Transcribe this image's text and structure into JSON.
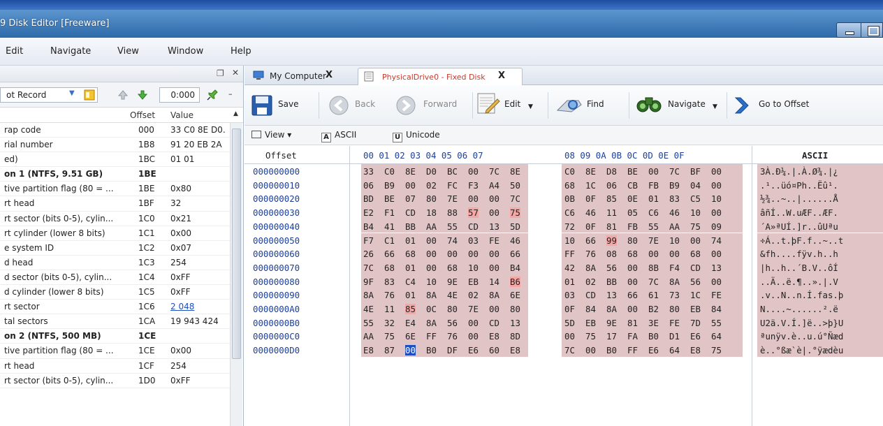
{
  "window": {
    "title": "9 Disk Editor [Freeware]"
  },
  "menu": [
    "Edit",
    "Navigate",
    "View",
    "Window",
    "Help"
  ],
  "left_panel": {
    "combo_value": "ot Record",
    "offset_value": "0:000",
    "columns": {
      "offset": "Offset",
      "value": "Value"
    },
    "rows": [
      {
        "name": "rap code",
        "offset": "000",
        "value": "33 C0 8E D0.",
        "bold": false
      },
      {
        "name": "rial number",
        "offset": "1B8",
        "value": "91 20 EB 2A",
        "bold": false
      },
      {
        "name": "ed)",
        "offset": "1BC",
        "value": "01 01",
        "bold": false
      },
      {
        "name": "on 1 (NTFS, 9.51 GB)",
        "offset": "1BE",
        "value": "",
        "bold": true
      },
      {
        "name": "tive partition flag (80 = ...",
        "offset": "1BE",
        "value": "0x80",
        "bold": false
      },
      {
        "name": "rt head",
        "offset": "1BF",
        "value": "32",
        "bold": false
      },
      {
        "name": "rt sector (bits 0-5), cylin...",
        "offset": "1C0",
        "value": "0x21",
        "bold": false
      },
      {
        "name": "rt cylinder (lower 8 bits)",
        "offset": "1C1",
        "value": "0x00",
        "bold": false
      },
      {
        "name": "e system ID",
        "offset": "1C2",
        "value": "0x07",
        "bold": false
      },
      {
        "name": "d head",
        "offset": "1C3",
        "value": "254",
        "bold": false
      },
      {
        "name": "d sector (bits 0-5), cylin...",
        "offset": "1C4",
        "value": "0xFF",
        "bold": false
      },
      {
        "name": "d cylinder (lower 8 bits)",
        "offset": "1C5",
        "value": "0xFF",
        "bold": false
      },
      {
        "name": "rt sector",
        "offset": "1C6",
        "value": "2 048",
        "bold": false,
        "link": true
      },
      {
        "name": "tal sectors",
        "offset": "1CA",
        "value": "19 943 424",
        "bold": false
      },
      {
        "name": "on 2 (NTFS, 500 MB)",
        "offset": "1CE",
        "value": "",
        "bold": true
      },
      {
        "name": "tive partition flag (80 = ...",
        "offset": "1CE",
        "value": "0x00",
        "bold": false
      },
      {
        "name": "rt head",
        "offset": "1CF",
        "value": "254",
        "bold": false
      },
      {
        "name": "rt sector (bits 0-5), cylin...",
        "offset": "1D0",
        "value": "0xFF",
        "bold": false
      }
    ]
  },
  "tabs": [
    {
      "label": "My Computer",
      "close": "X"
    },
    {
      "label": "PhysicalDrive0 - Fixed Disk",
      "close": "X"
    }
  ],
  "toolbar": {
    "save": "Save",
    "back": "Back",
    "forward": "Forward",
    "edit": "Edit",
    "find": "Find",
    "navigate": "Navigate",
    "goto": "Go to Offset"
  },
  "viewbar": {
    "view": "View",
    "ascii": "ASCII",
    "unicode": "Unicode"
  },
  "hex": {
    "offset_header": "Offset",
    "col_header_1": "00 01 02 03 04 05 06 07",
    "col_header_2": "08 09 0A 0B 0C 0D 0E 0F",
    "ascii_header": "ASCII",
    "rows": [
      {
        "offset": "000000000",
        "bytes": [
          "33",
          "C0",
          "8E",
          "D0",
          "BC",
          "00",
          "7C",
          "8E",
          "C0",
          "8E",
          "D8",
          "BE",
          "00",
          "7C",
          "BF",
          "00"
        ],
        "ascii": "3À.Ð¼.|.À.Ø¾.|¿"
      },
      {
        "offset": "000000010",
        "bytes": [
          "06",
          "B9",
          "00",
          "02",
          "FC",
          "F3",
          "A4",
          "50",
          "68",
          "1C",
          "06",
          "CB",
          "FB",
          "B9",
          "04",
          "00"
        ],
        "ascii": ".¹..üó¤Ph..Ëû¹."
      },
      {
        "offset": "000000020",
        "bytes": [
          "BD",
          "BE",
          "07",
          "80",
          "7E",
          "00",
          "00",
          "7C",
          "0B",
          "0F",
          "85",
          "0E",
          "01",
          "83",
          "C5",
          "10"
        ],
        "ascii": "½¾..~..|......Å"
      },
      {
        "offset": "000000030",
        "bytes": [
          "E2",
          "F1",
          "CD",
          "18",
          "88",
          "57",
          "00",
          "75",
          "C6",
          "46",
          "11",
          "05",
          "C6",
          "46",
          "10",
          "00"
        ],
        "ascii": "âñÍ..W.uÆF..ÆF."
      },
      {
        "offset": "000000040",
        "bytes": [
          "B4",
          "41",
          "BB",
          "AA",
          "55",
          "CD",
          "13",
          "5D",
          "72",
          "0F",
          "81",
          "FB",
          "55",
          "AA",
          "75",
          "09"
        ],
        "ascii": "´A»ªUÍ.]r..ûUªu"
      },
      {
        "offset": "000000050",
        "bytes": [
          "F7",
          "C1",
          "01",
          "00",
          "74",
          "03",
          "FE",
          "46",
          "10",
          "66",
          "99",
          "80",
          "7E",
          "10",
          "00",
          "74"
        ],
        "ascii": "÷Á..t.þF.f..~..t"
      },
      {
        "offset": "000000060",
        "bytes": [
          "26",
          "66",
          "68",
          "00",
          "00",
          "00",
          "00",
          "66",
          "FF",
          "76",
          "08",
          "68",
          "00",
          "00",
          "68",
          "00"
        ],
        "ascii": "&fh....fÿv.h..h"
      },
      {
        "offset": "000000070",
        "bytes": [
          "7C",
          "68",
          "01",
          "00",
          "68",
          "10",
          "00",
          "B4",
          "42",
          "8A",
          "56",
          "00",
          "8B",
          "F4",
          "CD",
          "13"
        ],
        "ascii": "|h..h..´B.V..ôÍ"
      },
      {
        "offset": "000000080",
        "bytes": [
          "9F",
          "83",
          "C4",
          "10",
          "9E",
          "EB",
          "14",
          "B6",
          "01",
          "02",
          "BB",
          "00",
          "7C",
          "8A",
          "56",
          "00"
        ],
        "ascii": "..Ä..ë.¶..».|.V"
      },
      {
        "offset": "000000090",
        "bytes": [
          "8A",
          "76",
          "01",
          "8A",
          "4E",
          "02",
          "8A",
          "6E",
          "03",
          "CD",
          "13",
          "66",
          "61",
          "73",
          "1C",
          "FE"
        ],
        "ascii": ".v..N..n.Í.fas.þ"
      },
      {
        "offset": "0000000A0",
        "bytes": [
          "4E",
          "11",
          "85",
          "0C",
          "80",
          "7E",
          "00",
          "80",
          "0F",
          "84",
          "8A",
          "00",
          "B2",
          "80",
          "EB",
          "84"
        ],
        "ascii": "N....~......².ë"
      },
      {
        "offset": "0000000B0",
        "bytes": [
          "55",
          "32",
          "E4",
          "8A",
          "56",
          "00",
          "CD",
          "13",
          "5D",
          "EB",
          "9E",
          "81",
          "3E",
          "FE",
          "7D",
          "55"
        ],
        "ascii": "U2ä.V.Í.]ë..>þ}U"
      },
      {
        "offset": "0000000C0",
        "bytes": [
          "AA",
          "75",
          "6E",
          "FF",
          "76",
          "00",
          "E8",
          "8D",
          "00",
          "75",
          "17",
          "FA",
          "B0",
          "D1",
          "E6",
          "64"
        ],
        "ascii": "ªunÿv.è..u.ú°Ñæd"
      },
      {
        "offset": "0000000D0",
        "bytes": [
          "E8",
          "87",
          "00",
          "B0",
          "DF",
          "E6",
          "60",
          "E8",
          "7C",
          "00",
          "B0",
          "FF",
          "E6",
          "64",
          "E8",
          "75"
        ],
        "ascii": "è..°ßæ`è|.°ÿædèu"
      }
    ]
  }
}
